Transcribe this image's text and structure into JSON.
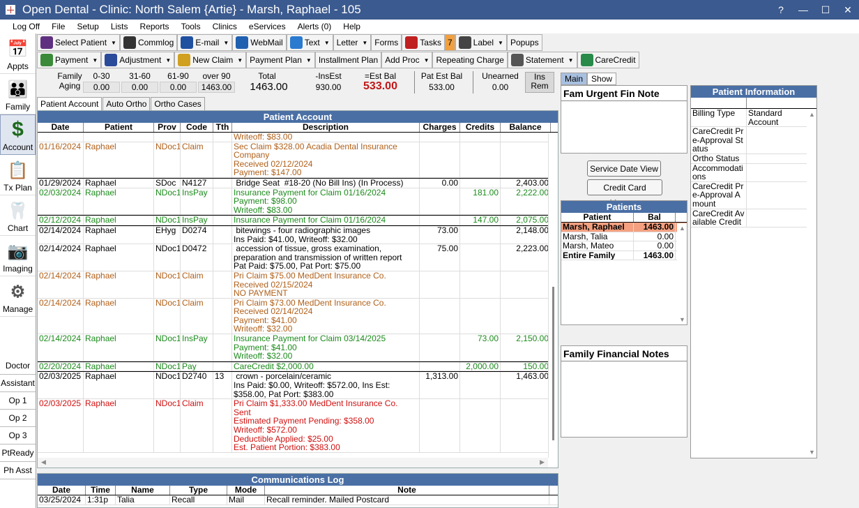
{
  "window": {
    "title": "Open Dental - Clinic: North Salem {Artie} - Marsh, Raphael - 105",
    "help": "?",
    "minimize": "—",
    "maximize": "☐",
    "close": "✕"
  },
  "menu": [
    "Log Off",
    "File",
    "Setup",
    "Lists",
    "Reports",
    "Tools",
    "Clinics",
    "eServices",
    "Alerts (0)",
    "Help"
  ],
  "outlook": [
    "Appts",
    "Family",
    "Account",
    "Tx Plan",
    "Chart",
    "Imaging",
    "Manage"
  ],
  "ops": [
    "Doctor",
    "Assistant",
    "Op 1",
    "Op 2",
    "Op 3",
    "PtReady",
    "Ph Asst"
  ],
  "toolbar1": [
    "Select Patient",
    "Commlog",
    "E-mail",
    "WebMail",
    "Text",
    "Letter",
    "Forms",
    "Tasks",
    "Label",
    "Popups"
  ],
  "toolbar2": [
    "Payment",
    "Adjustment",
    "New Claim",
    "Payment Plan",
    "Installment Plan",
    "Add Proc",
    "Repeating Charge",
    "Statement",
    "CareCredit"
  ],
  "tasks_badge": "7",
  "aging": {
    "family_label": "Family",
    "aging_label": "Aging",
    "cols": [
      "0-30",
      "31-60",
      "61-90",
      "over 90"
    ],
    "vals": [
      "0.00",
      "0.00",
      "0.00",
      "1463.00"
    ],
    "total_label": "Total",
    "total": "1463.00",
    "insest_label": "-InsEst",
    "insest": "930.00",
    "estbal_label": "=Est Bal",
    "estbal": "533.00",
    "patest_label": "Pat Est Bal",
    "patest": "533.00",
    "unearned_label": "Unearned",
    "unearned": "0.00",
    "insrem": "Ins Rem"
  },
  "tabs": [
    "Patient Account",
    "Auto Ortho",
    "Ortho Cases"
  ],
  "account": {
    "title": "Patient Account",
    "headers": [
      "Date",
      "Patient",
      "Prov",
      "Code",
      "Tth",
      "Description",
      "Charges",
      "Credits",
      "Balance"
    ],
    "rows": [
      {
        "c": "brown",
        "date": "",
        "patient": "",
        "prov": "",
        "code": "",
        "tth": "",
        "desc": [
          "Writeoff: $83.00"
        ],
        "charges": "",
        "credits": "",
        "balance": ""
      },
      {
        "c": "brown",
        "date": "01/16/2024",
        "patient": "Raphael",
        "prov": "NDoc1",
        "code": "Claim",
        "tth": "",
        "desc": [
          "Sec Claim $328.00 Acadia Dental Insurance",
          "Company",
          "Received 02/12/2024",
          "Payment: $147.00"
        ],
        "charges": "",
        "credits": "",
        "balance": ""
      },
      {
        "c": "black",
        "sep": true,
        "date": "01/29/2024",
        "patient": "Raphael",
        "prov": "SDoc",
        "code": "N4127",
        "tth": "",
        "desc": [
          " Bridge Seat  #18-20 (No Bill Ins) (In Process)"
        ],
        "charges": "0.00",
        "credits": "",
        "balance": "2,403.00"
      },
      {
        "c": "green",
        "date": "02/03/2024",
        "patient": "Raphael",
        "prov": "NDoc1",
        "code": "InsPay",
        "tth": "",
        "desc": [
          "Insurance Payment for Claim 01/16/2024",
          "Payment: $98.00",
          "Writeoff: $83.00"
        ],
        "charges": "",
        "credits": "181.00",
        "balance": "2,222.00"
      },
      {
        "c": "green",
        "sep": true,
        "date": "02/12/2024",
        "patient": "Raphael",
        "prov": "NDoc1",
        "code": "InsPay",
        "tth": "",
        "desc": [
          "Insurance Payment for Claim 01/16/2024"
        ],
        "charges": "",
        "credits": "147.00",
        "balance": "2,075.00"
      },
      {
        "c": "black",
        "sep": true,
        "date": "02/14/2024",
        "patient": "Raphael",
        "prov": "EHyg",
        "code": "D0274",
        "tth": "",
        "desc": [
          " bitewings - four radiographic images",
          "Ins Paid: $41.00, Writeoff: $32.00"
        ],
        "charges": "73.00",
        "credits": "",
        "balance": "2,148.00"
      },
      {
        "c": "black",
        "date": "02/14/2024",
        "patient": "Raphael",
        "prov": "NDoc1",
        "code": "D0472",
        "tth": "",
        "desc": [
          " accession of tissue, gross examination,",
          "preparation and transmission of written report",
          "Pat Paid: $75.00, Pat Port: $75.00"
        ],
        "charges": "75.00",
        "credits": "",
        "balance": "2,223.00"
      },
      {
        "c": "brown",
        "date": "02/14/2024",
        "patient": "Raphael",
        "prov": "NDoc1",
        "code": "Claim",
        "tth": "",
        "desc": [
          "Pri Claim $75.00 MedDent Insurance Co.",
          "Received 02/15/2024",
          "NO PAYMENT"
        ],
        "charges": "",
        "credits": "",
        "balance": ""
      },
      {
        "c": "brown",
        "date": "02/14/2024",
        "patient": "Raphael",
        "prov": "NDoc1",
        "code": "Claim",
        "tth": "",
        "desc": [
          "Pri Claim $73.00 MedDent Insurance Co.",
          "Received 02/14/2024",
          "Payment: $41.00",
          "Writeoff: $32.00"
        ],
        "charges": "",
        "credits": "",
        "balance": ""
      },
      {
        "c": "green",
        "date": "02/14/2024",
        "patient": "Raphael",
        "prov": "NDoc1",
        "code": "InsPay",
        "tth": "",
        "desc": [
          "Insurance Payment for Claim 03/14/2025",
          "Payment: $41.00",
          "Writeoff: $32.00"
        ],
        "charges": "",
        "credits": "73.00",
        "balance": "2,150.00"
      },
      {
        "c": "green",
        "sep": true,
        "date": "02/20/2024",
        "patient": "Raphael",
        "prov": "NDoc1",
        "code": "Pay",
        "tth": "",
        "desc": [
          "CareCredit $2,000.00"
        ],
        "charges": "",
        "credits": "2,000.00",
        "balance": "150.00"
      },
      {
        "c": "black",
        "sep": true,
        "date": "02/03/2025",
        "patient": "Raphael",
        "prov": "NDoc1",
        "code": "D2740",
        "tth": "13",
        "desc": [
          " crown - porcelain/ceramic",
          "Ins Paid: $0.00, Writeoff: $572.00, Ins Est:",
          "$358.00, Pat Port: $383.00"
        ],
        "charges": "1,313.00",
        "credits": "",
        "balance": "1,463.00"
      },
      {
        "c": "red",
        "date": "02/03/2025",
        "patient": "Raphael",
        "prov": "NDoc1",
        "code": "Claim",
        "tth": "",
        "desc": [
          "Pri Claim $1,333.00 MedDent Insurance Co.",
          "Sent",
          "Estimated Payment Pending: $358.00",
          "Writeoff: $572.00",
          "Deductible Applied: $25.00",
          "Est. Patient Portion: $383.00"
        ],
        "charges": "",
        "credits": "",
        "balance": ""
      }
    ]
  },
  "comm": {
    "title": "Communications Log",
    "headers": [
      "Date",
      "Time",
      "Name",
      "Type",
      "Mode",
      "Note"
    ],
    "rows": [
      [
        "03/25/2024",
        "1:31p",
        "Talia",
        "Recall",
        "Mail",
        "Recall reminder.  Mailed Postcard"
      ]
    ]
  },
  "right": {
    "tabs": [
      "Main",
      "Show"
    ],
    "urgent": "Fam Urgent Fin Note",
    "svc_btn": "Service Date View",
    "cc_btn": "Credit Card Manage",
    "patients_title": "Patients",
    "patients_headers": [
      "Patient",
      "Bal"
    ],
    "patients": [
      [
        "Marsh, Raphael",
        "1463.00"
      ],
      [
        "Marsh, Talia",
        "0.00"
      ],
      [
        "Marsh, Mateo",
        "0.00"
      ],
      [
        "Entire Family",
        "1463.00"
      ]
    ],
    "famfin": "Family Financial Notes"
  },
  "patinfo": {
    "title": "Patient Information",
    "rows": [
      [
        "Billing Type",
        "Standard Account"
      ],
      [
        "CareCredit Pre-Approval Status",
        ""
      ],
      [
        "Ortho Status",
        ""
      ],
      [
        "Accommodations",
        ""
      ],
      [
        "CareCredit Pre-Approval Amount",
        ""
      ],
      [
        "CareCredit Available Credit",
        ""
      ]
    ]
  },
  "colors": {
    "title_bar": "#3b5a8f",
    "grid_title": "#4a6fa5",
    "brown": "#b0601a",
    "green": "#1b8a1b",
    "red": "#d01010",
    "selected_patient": "#f4a080"
  }
}
